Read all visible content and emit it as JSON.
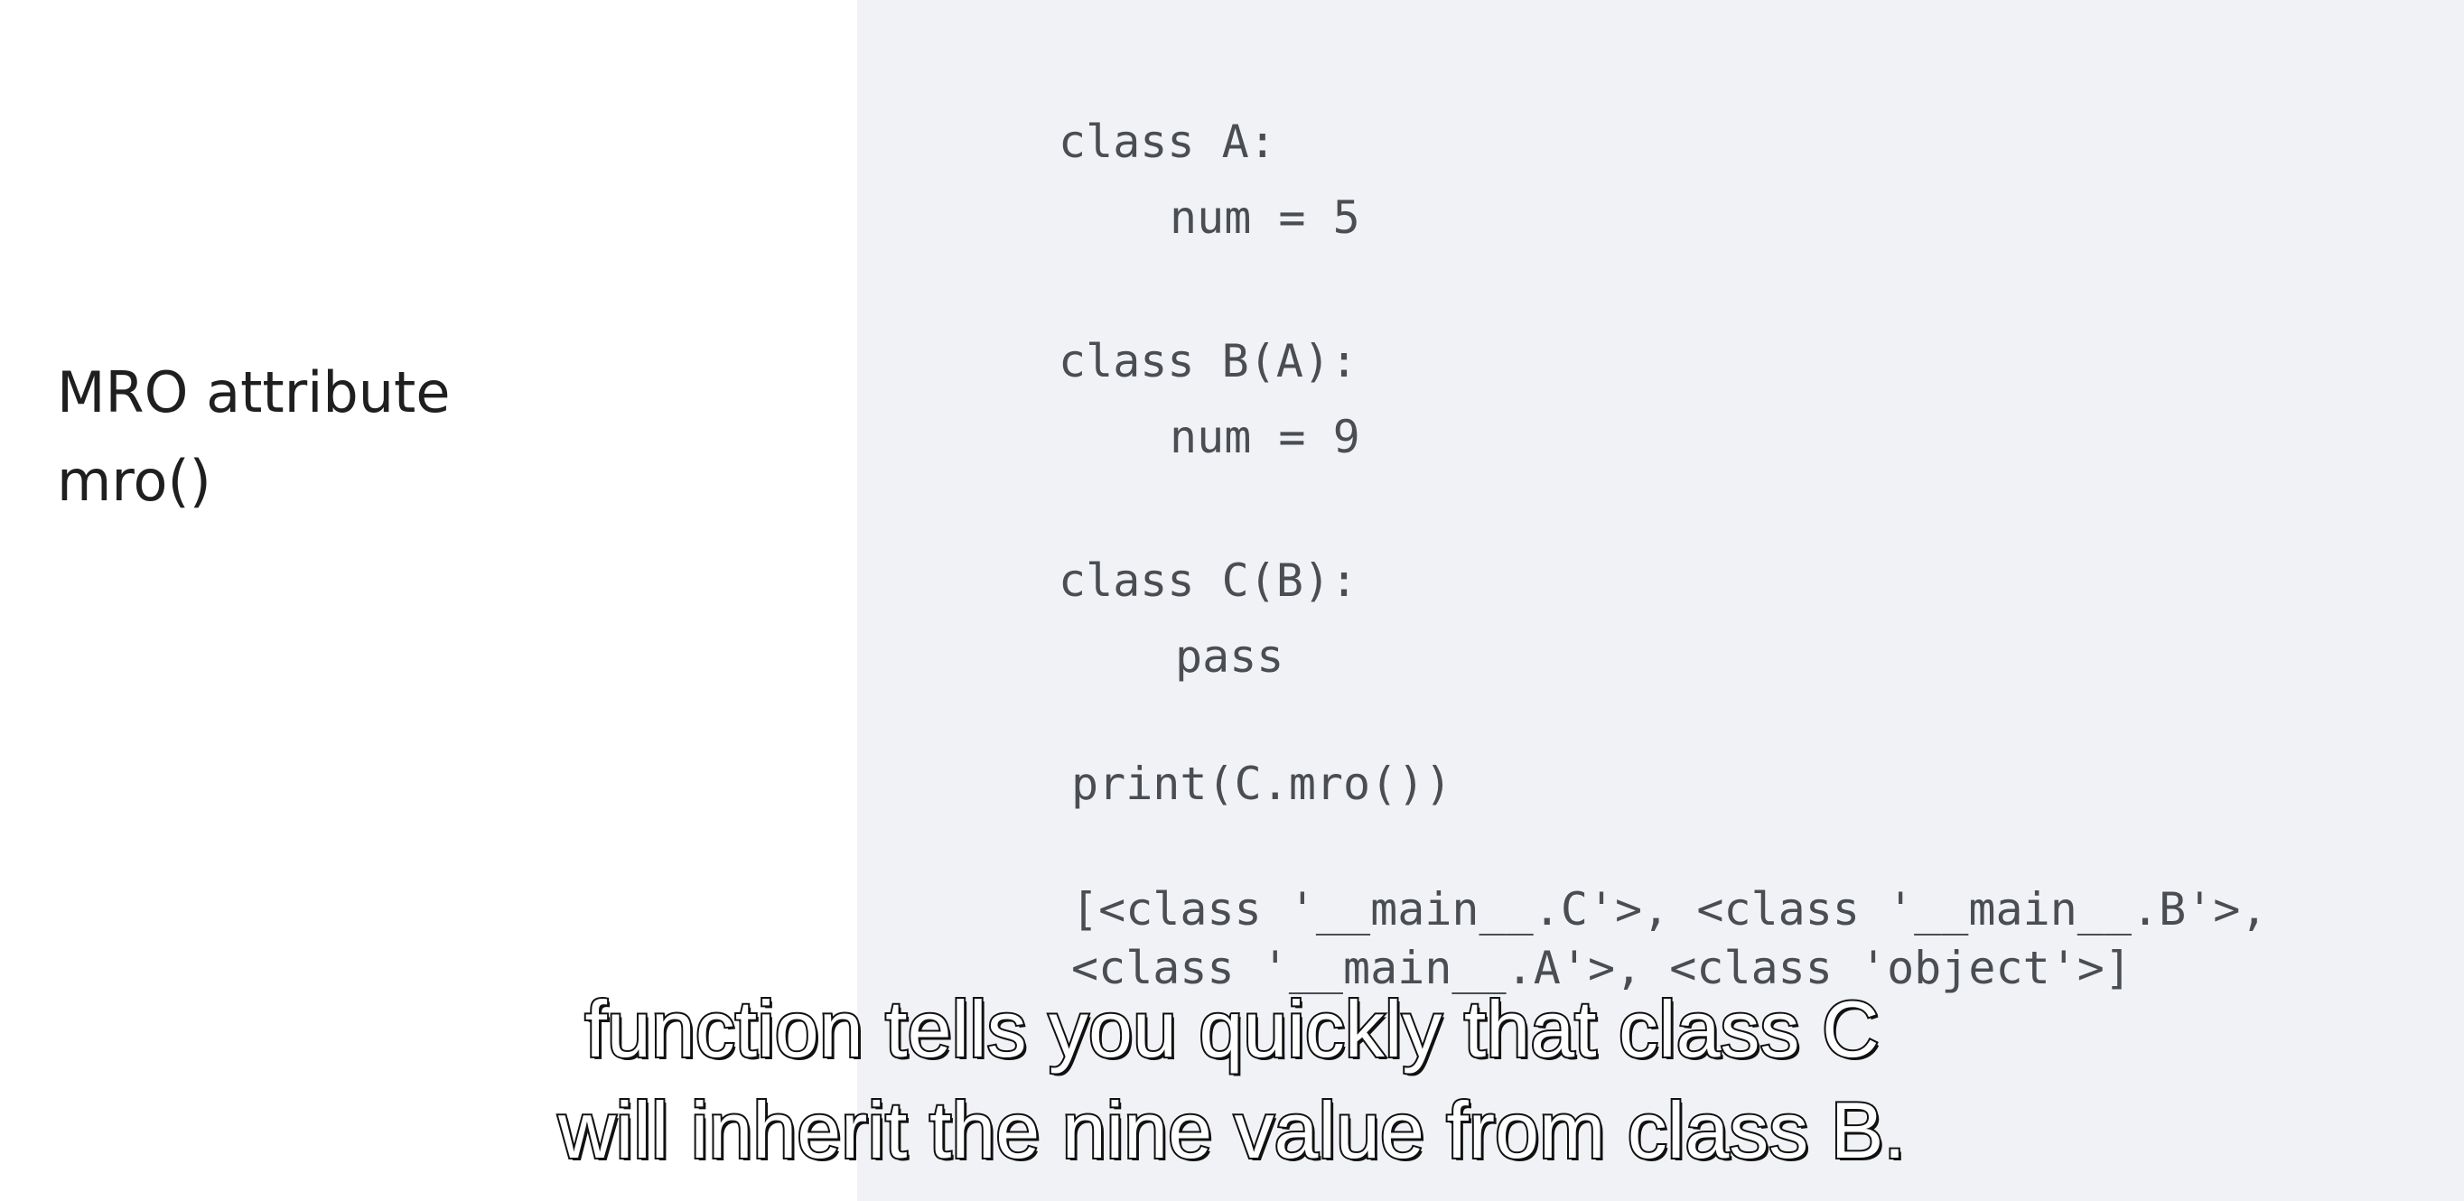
{
  "slide": {
    "topics": [
      "MRO attribute",
      "mro()"
    ],
    "code": {
      "lines": [
        "class A:",
        "num = 5",
        "class B(A):",
        "num = 9",
        "class C(B):",
        "pass",
        "print(C.mro())",
        "[<class '__main__.C'>, <class '__main__.B'>,",
        "<class '__main__.A'>, <class 'object'>]"
      ]
    },
    "caption": {
      "lines": [
        "function tells you quickly that class C",
        "will inherit the nine value from class B."
      ]
    }
  },
  "colors": {
    "code_background": "#f0f2f6",
    "code_text": "#4a4d52",
    "topic_text": "#1f1f1f",
    "caption_fill": "#ffffff",
    "caption_outline": "#111111"
  }
}
